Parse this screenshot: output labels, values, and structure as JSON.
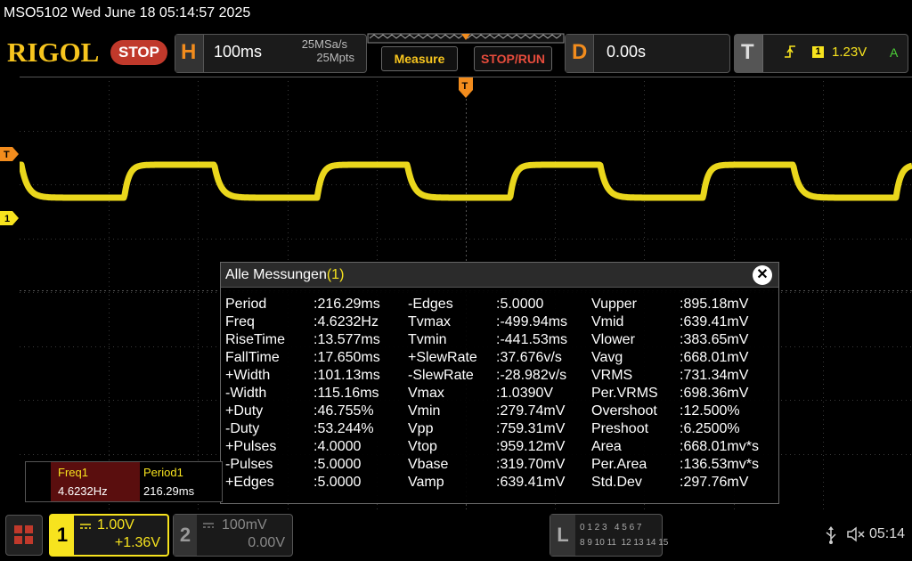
{
  "window": {
    "title": "MSO5102   Wed June 18 05:14:57 2025"
  },
  "header": {
    "logo": "RIGOL",
    "run_state": "STOP",
    "horizontal": {
      "letter": "H",
      "timebase": "100ms",
      "sample_rate": "25MSa/s",
      "memory_depth": "25Mpts"
    },
    "measure_label": "Measure",
    "stoprun_label": "STOP/RUN",
    "delay": {
      "letter": "D",
      "value": "0.00s"
    },
    "trigger": {
      "letter": "T",
      "source": "1",
      "level": "1.23V",
      "mode": "A"
    }
  },
  "markers": {
    "trigger_level": "T",
    "channel1": "1",
    "trigger_pos": "T"
  },
  "measurements": {
    "title": "Alle Messungen",
    "count": "(1)",
    "close_icon": "close-icon",
    "col1": [
      {
        "name": "Period",
        "value": ":216.29ms"
      },
      {
        "name": "Freq",
        "value": ":4.6232Hz"
      },
      {
        "name": "RiseTime",
        "value": ":13.577ms"
      },
      {
        "name": "FallTime",
        "value": ":17.650ms"
      },
      {
        "name": "+Width",
        "value": ":101.13ms"
      },
      {
        "name": "-Width",
        "value": ":115.16ms"
      },
      {
        "name": "+Duty",
        "value": ":46.755%"
      },
      {
        "name": "-Duty",
        "value": ":53.244%"
      },
      {
        "name": "+Pulses",
        "value": ":4.0000"
      },
      {
        "name": "-Pulses",
        "value": ":5.0000"
      },
      {
        "name": "+Edges",
        "value": ":5.0000"
      }
    ],
    "col2": [
      {
        "name": "-Edges",
        "value": ":5.0000"
      },
      {
        "name": "Tvmax",
        "value": ":-499.94ms"
      },
      {
        "name": "Tvmin",
        "value": ":-441.53ms"
      },
      {
        "name": "+SlewRate",
        "value": ":37.676v/s"
      },
      {
        "name": "-SlewRate",
        "value": ":-28.982v/s"
      },
      {
        "name": "Vmax",
        "value": ":1.0390V"
      },
      {
        "name": "Vmin",
        "value": ":279.74mV"
      },
      {
        "name": "Vpp",
        "value": ":759.31mV"
      },
      {
        "name": "Vtop",
        "value": ":959.12mV"
      },
      {
        "name": "Vbase",
        "value": ":319.70mV"
      },
      {
        "name": "Vamp",
        "value": ":639.41mV"
      }
    ],
    "col3": [
      {
        "name": "Vupper",
        "value": ":895.18mV"
      },
      {
        "name": "Vmid",
        "value": ":639.41mV"
      },
      {
        "name": "Vlower",
        "value": ":383.65mV"
      },
      {
        "name": "Vavg",
        "value": ":668.01mV"
      },
      {
        "name": "VRMS",
        "value": ":731.34mV"
      },
      {
        "name": "Per.VRMS",
        "value": ":698.36mV"
      },
      {
        "name": "Overshoot",
        "value": ":12.500%"
      },
      {
        "name": "Preshoot",
        "value": ":6.2500%"
      },
      {
        "name": "Area",
        "value": ":668.01mv*s"
      },
      {
        "name": "Per.Area",
        "value": ":136.53mv*s"
      },
      {
        "name": "Std.Dev",
        "value": ":297.76mV"
      }
    ]
  },
  "counter": {
    "freq_label": "Freq1",
    "freq_value": "4.6232Hz",
    "period_label": "Period1",
    "period_value": "216.29ms"
  },
  "channels": {
    "ch1": {
      "number": "1",
      "scale": "1.00V",
      "offset": "+1.36V"
    },
    "ch2": {
      "number": "2",
      "scale": "100mV",
      "offset": "0.00V"
    }
  },
  "logic": {
    "letter": "L",
    "row1": "0 1 2 3   4 5 6 7",
    "row2": "8 9 10 11  12 13 14 15"
  },
  "status": {
    "time": "05:14",
    "usb_icon": "usb-icon",
    "speaker_icon": "speaker-muted-icon"
  },
  "colors": {
    "ch1": "#f7e31e",
    "accent": "#f28c1d",
    "stop": "#c0392b"
  }
}
